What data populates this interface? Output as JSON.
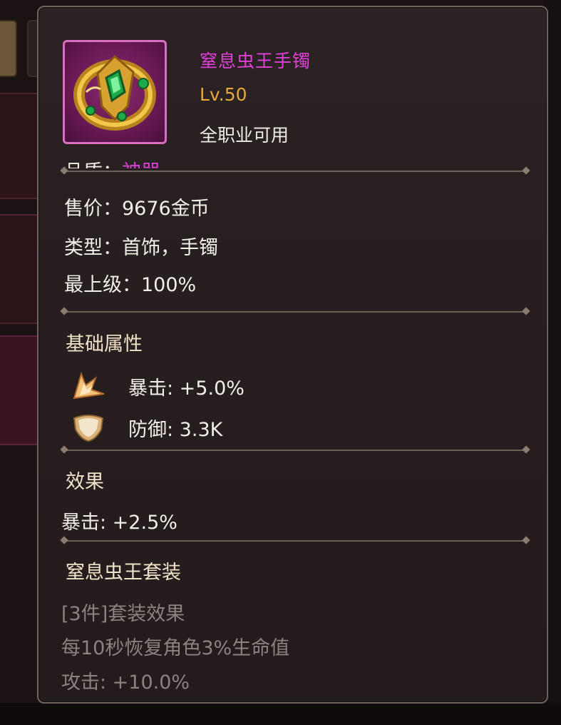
{
  "item": {
    "name": "窒息虫王手镯",
    "level": "Lv.50",
    "usable": "全职业可用",
    "icon": "golden-bracelet-emerald-icon",
    "frame_color": "#d96fbf"
  },
  "info": {
    "quality_label": "品质：",
    "quality_value": "神器",
    "price_label": "售价：",
    "price_value": "9676金币",
    "type_label": "类型：",
    "type_value": "首饰，手镯",
    "upgrade_label": "最上级：",
    "upgrade_value": "100%"
  },
  "base_attributes": {
    "title": "基础属性",
    "stats": [
      {
        "label": "暴击: +5.0%",
        "icon": "crit-burst-icon"
      },
      {
        "label": "防御: 3.3K",
        "icon": "shield-icon"
      }
    ]
  },
  "effects": {
    "title": "效果",
    "lines": [
      "暴击: +2.5%"
    ]
  },
  "set": {
    "title": "窒息虫王套装",
    "header": "[3件]套装效果",
    "lines": [
      "每10秒恢复角色3%生命值",
      "攻击: +10.0%"
    ]
  },
  "colors": {
    "name": "#e040d8",
    "level": "#e8a83a",
    "inactive": "#8b8380"
  }
}
